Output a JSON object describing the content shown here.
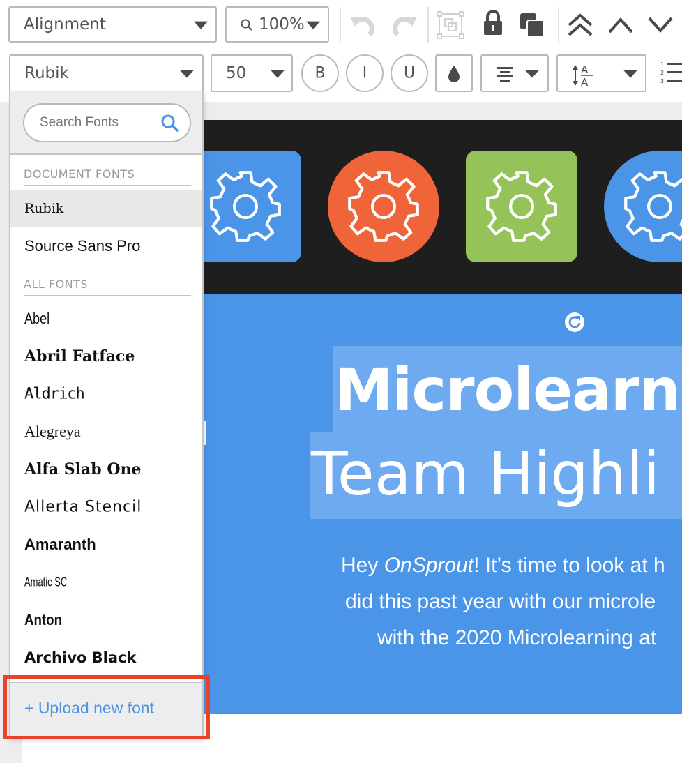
{
  "toolbar_top": {
    "alignment_label": "Alignment",
    "zoom_label": "100%",
    "icons": [
      "search-icon",
      "undo-icon",
      "redo-icon",
      "group-icon",
      "lock-icon",
      "duplicate-icon",
      "bring-to-front-icon",
      "bring-forward-icon",
      "send-backward-icon"
    ]
  },
  "toolbar_text": {
    "font_label": "Rubik",
    "size_label": "50",
    "bold_label": "B",
    "italic_label": "I",
    "underline_label": "U",
    "icons": [
      "color-drop-icon",
      "text-align-icon",
      "line-spacing-icon",
      "numbered-list-icon"
    ]
  },
  "font_dropdown": {
    "search_placeholder": "Search Fonts",
    "document_fonts_heading": "DOCUMENT FONTS",
    "document_fonts": [
      "Rubik",
      "Source Sans Pro"
    ],
    "all_fonts_heading": "ALL FONTS",
    "all_fonts": [
      "Abel",
      "Abril Fatface",
      "Aldrich",
      "Alegreya",
      "Alfa Slab One",
      "Allerta Stencil",
      "Amaranth",
      "Amatic SC",
      "Anton",
      "Archivo Black"
    ],
    "upload_label": "+ Upload new font"
  },
  "canvas": {
    "title_line1": "Microlearn",
    "title_line2": "Team Highli",
    "body_line1_prefix": "Hey ",
    "body_line1_italic": "OnSprout",
    "body_line1_suffix": "! It’s time to look at h",
    "body_line2": "did this past year with our microle",
    "body_line3": "with the 2020 Microlearning at",
    "shape_colors": [
      "#4a95e8",
      "#f0643a",
      "#96c25a",
      "#4a95e8"
    ],
    "section_color": "#4a95e8",
    "highlight_color": "#e8412c"
  }
}
